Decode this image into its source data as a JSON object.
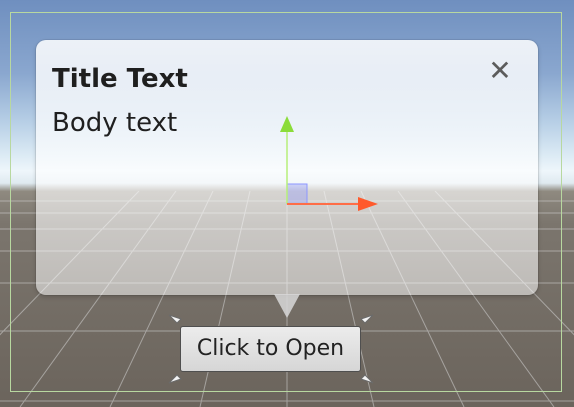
{
  "popup": {
    "title": "Title Text",
    "body": "Body text"
  },
  "close_icon": "close-icon",
  "open_button": {
    "label": "Click to Open"
  },
  "colors": {
    "sky_top": "#6f8fbf",
    "horizon": "#eef6fb",
    "ground": "#6b645c",
    "canvas_frame": "#b8d8a0",
    "gizmo_y": "#8bdc3a",
    "gizmo_x": "#ff5a2c"
  },
  "icons": [
    "close-icon",
    "move-gizmo-icon",
    "resize-handle-icon"
  ]
}
